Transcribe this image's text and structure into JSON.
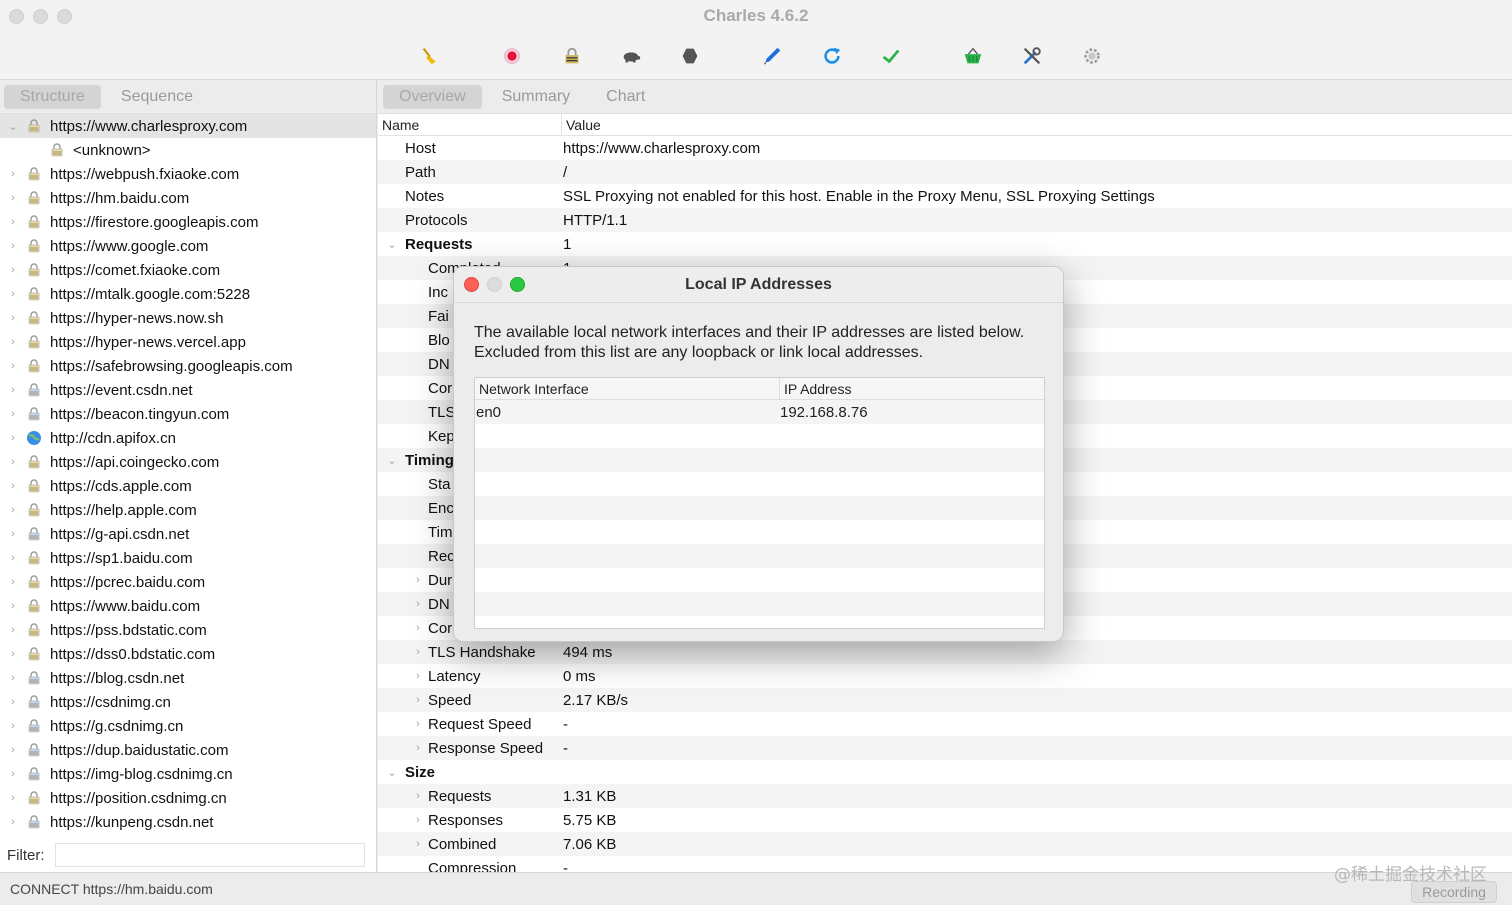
{
  "window": {
    "title": "Charles 4.6.2"
  },
  "toolbar": {
    "tools": [
      {
        "name": "broom-icon",
        "color": "#f2b705"
      },
      {
        "name": "record-icon",
        "color": "#e0143c"
      },
      {
        "name": "ssl-lock-icon",
        "color": "#8a8a8a"
      },
      {
        "name": "throttle-turtle-icon",
        "color": "#555555"
      },
      {
        "name": "stop-hexagon-icon",
        "color": "#555555"
      },
      {
        "name": "compose-pen-icon",
        "color": "#1e6fd9"
      },
      {
        "name": "refresh-icon",
        "color": "#1e8fe8"
      },
      {
        "name": "validate-check-icon",
        "color": "#2bb34a"
      },
      {
        "name": "basket-icon",
        "color": "#2bb34a"
      },
      {
        "name": "tools-icon",
        "color": "#2d6fd8"
      },
      {
        "name": "settings-gear-icon",
        "color": "#9a9a9a"
      }
    ]
  },
  "left_tabs": [
    "Structure",
    "Sequence"
  ],
  "right_tabs": [
    "Overview",
    "Summary",
    "Chart"
  ],
  "tree": [
    {
      "label": "https://www.charlesproxy.com",
      "expanded": true,
      "icon": "lock-icon",
      "selected": true
    },
    {
      "label": "<unknown>",
      "child": true,
      "icon": "lock-icon"
    },
    {
      "label": "https://webpush.fxiaoke.com",
      "icon": "lock-icon"
    },
    {
      "label": "https://hm.baidu.com",
      "icon": "lock-icon"
    },
    {
      "label": "https://firestore.googleapis.com",
      "icon": "lock-icon"
    },
    {
      "label": "https://www.google.com",
      "icon": "lock-icon"
    },
    {
      "label": "https://comet.fxiaoke.com",
      "icon": "lock-icon"
    },
    {
      "label": "https://mtalk.google.com:5228",
      "icon": "lock-icon"
    },
    {
      "label": "https://hyper-news.now.sh",
      "icon": "lock-icon"
    },
    {
      "label": "https://hyper-news.vercel.app",
      "icon": "lock-icon"
    },
    {
      "label": "https://safebrowsing.googleapis.com",
      "icon": "lock-icon"
    },
    {
      "label": "https://event.csdn.net",
      "icon": "lock-blue-icon"
    },
    {
      "label": "https://beacon.tingyun.com",
      "icon": "lock-blue-icon"
    },
    {
      "label": "http://cdn.apifox.cn",
      "icon": "globe-icon"
    },
    {
      "label": "https://api.coingecko.com",
      "icon": "lock-icon"
    },
    {
      "label": "https://cds.apple.com",
      "icon": "lock-icon"
    },
    {
      "label": "https://help.apple.com",
      "icon": "lock-icon"
    },
    {
      "label": "https://g-api.csdn.net",
      "icon": "lock-blue-icon"
    },
    {
      "label": "https://sp1.baidu.com",
      "icon": "lock-icon"
    },
    {
      "label": "https://pcrec.baidu.com",
      "icon": "lock-icon"
    },
    {
      "label": "https://www.baidu.com",
      "icon": "lock-icon"
    },
    {
      "label": "https://pss.bdstatic.com",
      "icon": "lock-icon"
    },
    {
      "label": "https://dss0.bdstatic.com",
      "icon": "lock-icon"
    },
    {
      "label": "https://blog.csdn.net",
      "icon": "lock-blue-icon"
    },
    {
      "label": "https://csdnimg.cn",
      "icon": "lock-blue-icon"
    },
    {
      "label": "https://g.csdnimg.cn",
      "icon": "lock-blue-icon"
    },
    {
      "label": "https://dup.baidustatic.com",
      "icon": "lock-blue-icon"
    },
    {
      "label": "https://img-blog.csdnimg.cn",
      "icon": "lock-blue-icon"
    },
    {
      "label": "https://position.csdnimg.cn",
      "icon": "lock-icon"
    },
    {
      "label": "https://kunpeng.csdn.net",
      "icon": "lock-blue-icon"
    }
  ],
  "filter": {
    "label": "Filter:",
    "value": ""
  },
  "overview": {
    "columns": [
      "Name",
      "Value"
    ],
    "rows": [
      {
        "name": "Host",
        "value": "https://www.charlesproxy.com",
        "level": 0
      },
      {
        "name": "Path",
        "value": "/",
        "level": 0
      },
      {
        "name": "Notes",
        "value": "SSL Proxying not enabled for this host. Enable in the Proxy Menu, SSL Proxying Settings",
        "level": 0
      },
      {
        "name": "Protocols",
        "value": "HTTP/1.1",
        "level": 0
      },
      {
        "name": "Requests",
        "value": "1",
        "level": 0,
        "group": true
      },
      {
        "name": "Completed",
        "value": "1",
        "level": 1
      },
      {
        "name": "Inc",
        "value": "",
        "level": 1
      },
      {
        "name": "Fai",
        "value": "",
        "level": 1
      },
      {
        "name": "Blo",
        "value": "",
        "level": 1
      },
      {
        "name": "DN",
        "value": "",
        "level": 1
      },
      {
        "name": "Cor",
        "value": "",
        "level": 1
      },
      {
        "name": "TLS",
        "value": "",
        "level": 1
      },
      {
        "name": "Kep",
        "value": "",
        "level": 1
      },
      {
        "name": "Timing",
        "value": "",
        "level": 0,
        "group": true
      },
      {
        "name": "Sta",
        "value": "",
        "level": 1
      },
      {
        "name": "Enc",
        "value": "",
        "level": 1
      },
      {
        "name": "Tim",
        "value": "",
        "level": 1
      },
      {
        "name": "Rec",
        "value": "",
        "level": 1
      },
      {
        "name": "Dur",
        "value": "",
        "level": 1,
        "expandable": true
      },
      {
        "name": "DN",
        "value": "",
        "level": 1,
        "expandable": true
      },
      {
        "name": "Cor",
        "value": "",
        "level": 1,
        "expandable": true
      },
      {
        "name": "TLS Handshake",
        "value": "494 ms",
        "level": 1,
        "expandable": true
      },
      {
        "name": "Latency",
        "value": "0 ms",
        "level": 1,
        "expandable": true
      },
      {
        "name": "Speed",
        "value": "2.17 KB/s",
        "level": 1,
        "expandable": true
      },
      {
        "name": "Request Speed",
        "value": "-",
        "level": 1,
        "expandable": true
      },
      {
        "name": "Response Speed",
        "value": "-",
        "level": 1,
        "expandable": true
      },
      {
        "name": "Size",
        "value": "",
        "level": 0,
        "group": true
      },
      {
        "name": "Requests",
        "value": "1.31 KB",
        "level": 1,
        "expandable": true
      },
      {
        "name": "Responses",
        "value": "5.75 KB",
        "level": 1,
        "expandable": true
      },
      {
        "name": "Combined",
        "value": "7.06 KB",
        "level": 1,
        "expandable": true
      },
      {
        "name": "Compression",
        "value": "-",
        "level": 1
      }
    ]
  },
  "dialog": {
    "title": "Local IP Addresses",
    "description": "The available local network interfaces and their IP addresses are listed below.  Excluded from this list are any loopback or link local addresses.",
    "columns": [
      "Network Interface",
      "IP Address"
    ],
    "rows": [
      {
        "iface": "en0",
        "ip": "192.168.8.76"
      }
    ],
    "empty_rows": 9
  },
  "status": {
    "text": "CONNECT https://hm.baidu.com",
    "recording": "Recording"
  },
  "watermark": "@稀土掘金技术社区"
}
